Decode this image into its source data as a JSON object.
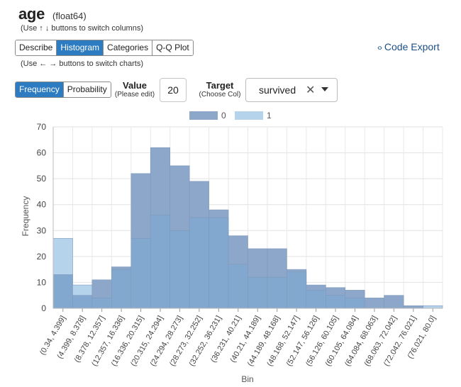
{
  "header": {
    "column_name": "age",
    "dtype": "(float64)",
    "column_hint": "(Use ↑ ↓ buttons to switch columns)",
    "chart_hint": "(Use ← → buttons to switch charts)"
  },
  "tabs": [
    {
      "label": "Describe",
      "active": false
    },
    {
      "label": "Histogram",
      "active": true
    },
    {
      "label": "Categories",
      "active": false
    },
    {
      "label": "Q-Q Plot",
      "active": false
    }
  ],
  "code_export": {
    "icon": "code-icon",
    "label": "Code Export"
  },
  "mode_toggle": [
    {
      "label": "Frequency",
      "active": true
    },
    {
      "label": "Probability",
      "active": false
    }
  ],
  "value_control": {
    "label": "Value",
    "sub": "(Please edit)",
    "value": "20"
  },
  "target_control": {
    "label": "Target",
    "sub": "(Choose Col)",
    "value": "survived",
    "clear_icon": "close-icon",
    "caret_icon": "chevron-down-icon"
  },
  "colors": {
    "series_0": "#8ca7c9",
    "series_1": "#b6d3ec",
    "overlap": "#83a8cf",
    "accent": "#2d7cc1"
  },
  "chart_data": {
    "type": "bar",
    "xlabel": "Bin",
    "ylabel": "Frequency",
    "ylim": [
      0,
      70
    ],
    "yticks": [
      0,
      10,
      20,
      30,
      40,
      50,
      60,
      70
    ],
    "grid": true,
    "legend_placement": "top-center",
    "categories": [
      "(0.34, 4.399]",
      "(4.399, 8.378]",
      "(8.378, 12.357]",
      "(12.357, 16.336]",
      "(16.336, 20.315]",
      "(20.315, 24.294]",
      "(24.294, 28.273]",
      "(28.273, 32.252]",
      "(32.252, 36.231]",
      "(36.231, 40.21]",
      "(40.21, 44.189]",
      "(44.189, 48.168]",
      "(48.168, 52.147]",
      "(52.147, 56.126]",
      "(56.126, 60.105]",
      "(60.105, 64.084]",
      "(64.084, 68.063]",
      "(68.063, 72.042]",
      "(72.042, 76.021]",
      "(76.021, 80.0]"
    ],
    "series": [
      {
        "name": "0",
        "values": [
          13,
          5,
          11,
          16,
          52,
          62,
          55,
          49,
          38,
          28,
          23,
          23,
          15,
          9,
          8,
          7,
          4,
          5,
          1,
          0
        ]
      },
      {
        "name": "1",
        "values": [
          27,
          9,
          4,
          15,
          27,
          36,
          30,
          35,
          35,
          17,
          12,
          12,
          14,
          7,
          5,
          4,
          0,
          0,
          0,
          1
        ]
      }
    ]
  }
}
